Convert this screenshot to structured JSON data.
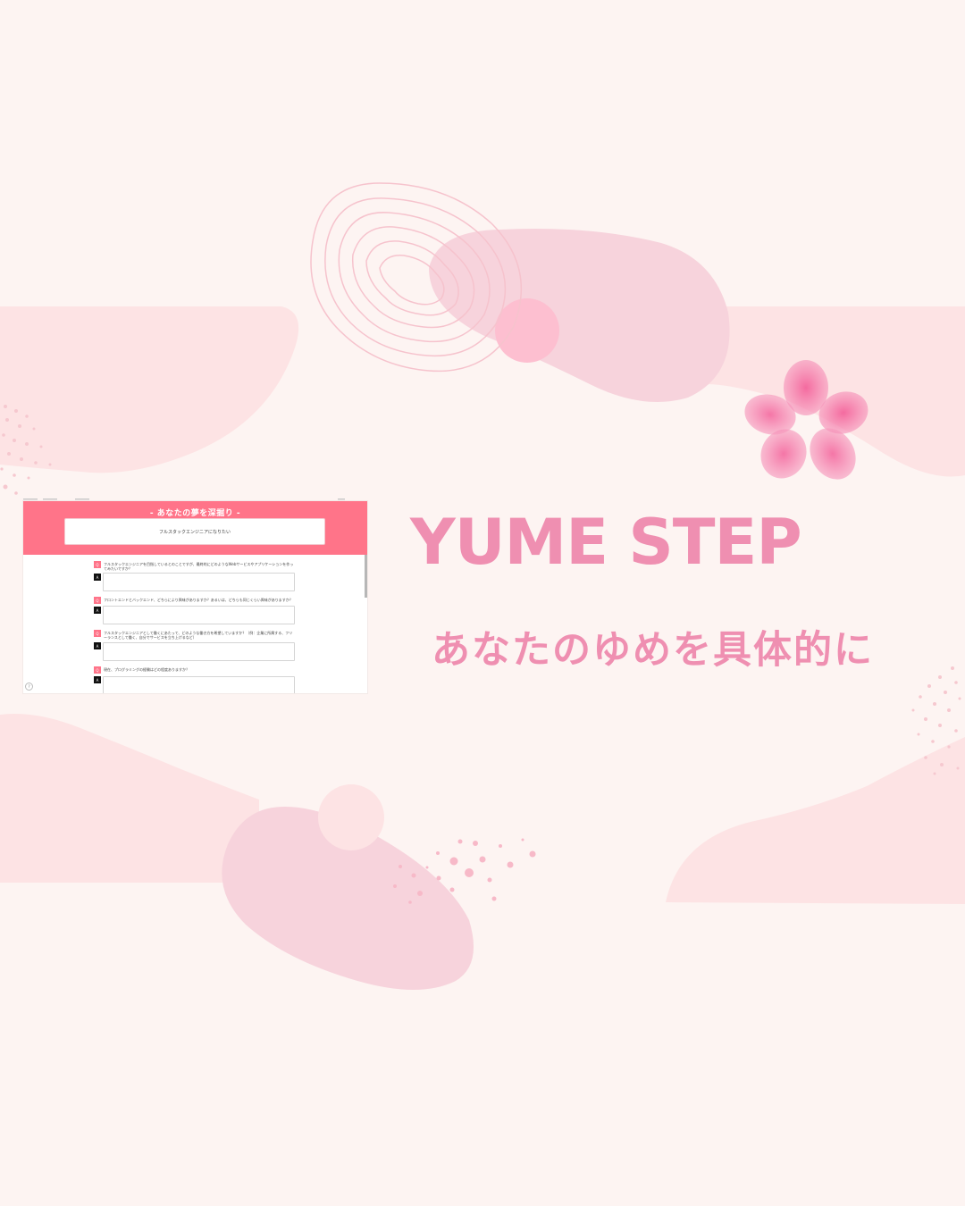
{
  "brand_title": "YUME STEP",
  "tagline": "あなたのゆめを具体的に",
  "screenshot": {
    "header_title": "- あなたの夢を深掘り -",
    "dream_text": "フルスタックエンジニアになりたい",
    "questions": [
      {
        "q_badge": "Q",
        "a_badge": "A",
        "text": "フルスタックエンジニアを目指しているとのことですが、最終的にどのようなWebサービスやアプリケーションを作ってみたいですか？"
      },
      {
        "q_badge": "Q",
        "a_badge": "A",
        "text": "フロントエンドとバックエンド、どちらにより興味がありますか？あるいは、どちらも同じくらい興味がありますか？"
      },
      {
        "q_badge": "Q",
        "a_badge": "A",
        "text": "フルスタックエンジニアとして働くにあたって、どのような働き方を希望していますか？（例：企業に所属する、フリーランスとして働く、自分でサービスを立ち上げるなど）"
      },
      {
        "q_badge": "Q",
        "a_badge": "A",
        "text": "現在、プログラミングの経験はどの程度ありますか？"
      }
    ]
  },
  "colors": {
    "background": "#fdf4f2",
    "accent_pink": "#ef8fb1",
    "header_pink": "#ff7489",
    "blob_pink": "#f7d3dc",
    "light_pink": "#fde3e4"
  },
  "icons": [
    "sakura-flower-icon",
    "help-icon"
  ]
}
